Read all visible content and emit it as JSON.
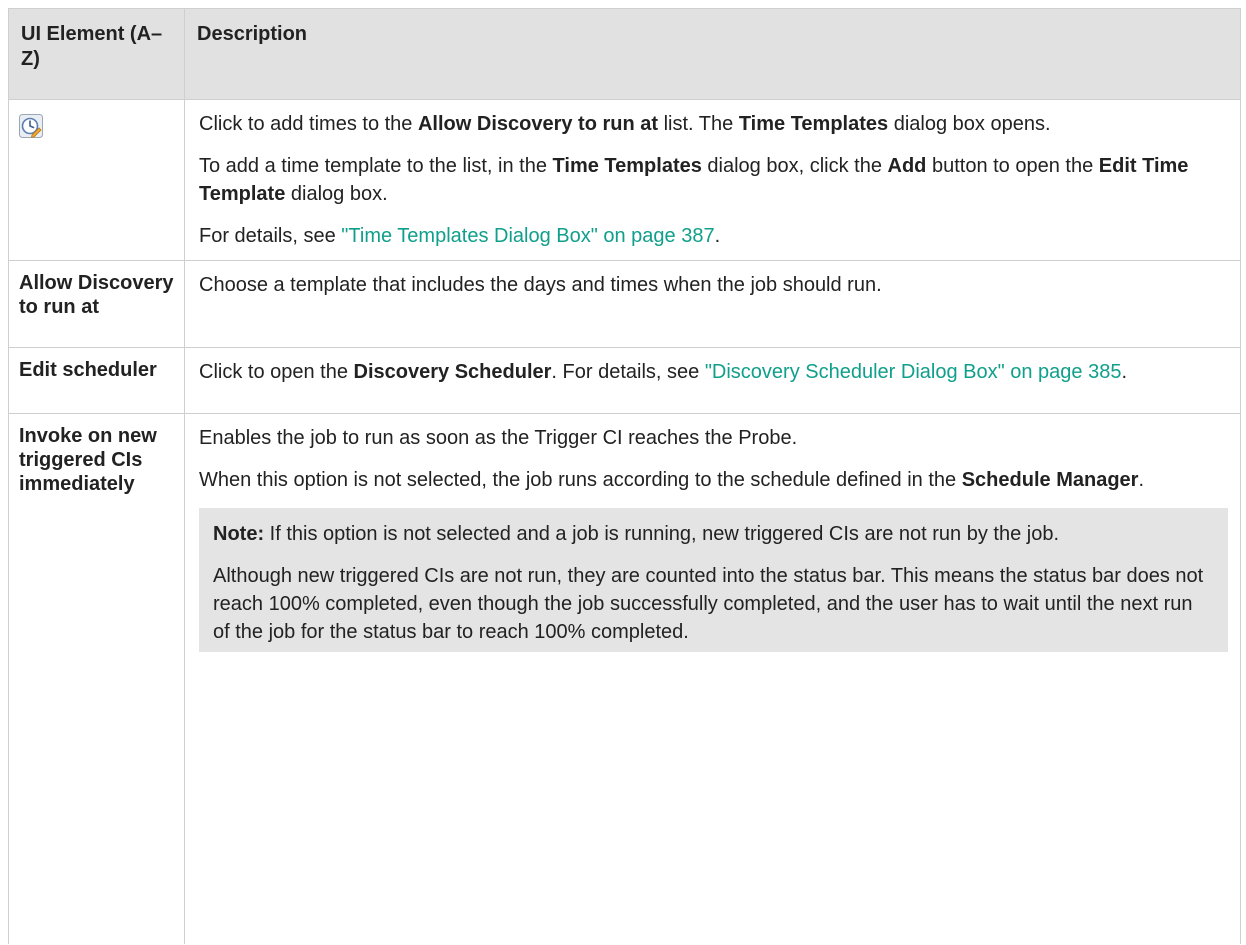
{
  "header": {
    "col1": "UI Element (A–Z)",
    "col2": "Description"
  },
  "rows": {
    "icon": {
      "icon_name": "time-template-add-icon",
      "desc1": {
        "t1": "Click to add times to the ",
        "b1": "Allow Discovery to run at",
        "t2": " list. The ",
        "b2": "Time Templates",
        "t3": " dialog box opens."
      },
      "desc2": {
        "t1": "To add a time template to the list, in the ",
        "b1": "Time Templates",
        "t2": " dialog box, click the ",
        "b2": "Add",
        "t3": " button to open the ",
        "b3": "Edit Time Template",
        "t4": " dialog box."
      },
      "desc3": {
        "t1": "For details, see ",
        "link": "\"Time Templates Dialog Box\" on page 387",
        "t2": "."
      }
    },
    "allow": {
      "name": "Allow Discovery to run at",
      "desc": "Choose a template that includes the days and times when the job should run."
    },
    "edit": {
      "name": "Edit scheduler",
      "t1": "Click to open the ",
      "b1": "Discovery Scheduler",
      "t2": ". For details, see ",
      "link": "\"Discovery Scheduler Dialog Box\" on page 385",
      "t3": "."
    },
    "invoke": {
      "name": "Invoke on new triggered CIs immediately",
      "desc1": "Enables the job to run as soon as the Trigger CI reaches the Probe.",
      "desc2": {
        "t1": "When this option is not selected, the job runs according to the schedule defined in the ",
        "b1": "Schedule Manager",
        "t2": "."
      },
      "note": {
        "label": "Note:",
        "text": " If this option is not selected and a job is running, new triggered CIs are not run by the job.",
        "para2": "Although new triggered CIs are not run, they are counted into the status bar. This means the status bar does not reach 100% completed, even though the job successfully completed, and the user has to wait until the next run of the job for the status bar to reach 100% completed."
      }
    }
  },
  "colors": {
    "link": "#0f9f8a",
    "header_bg": "#e1e1e1",
    "note_bg": "#e4e4e4",
    "border": "#cfcfcf"
  }
}
